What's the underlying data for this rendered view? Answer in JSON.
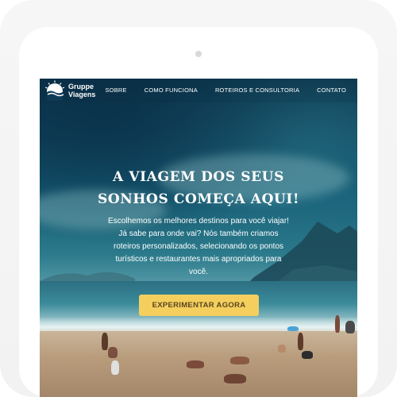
{
  "brand": {
    "name_line1": "Gruppe",
    "name_line2": "Viagens",
    "logo_icon": "sun-over-waves-icon"
  },
  "nav": {
    "items": [
      {
        "label": "SOBRE"
      },
      {
        "label": "COMO FUNCIONA"
      },
      {
        "label": "ROTEIROS E CONSULTORIA"
      },
      {
        "label": "CONTATO"
      }
    ]
  },
  "hero": {
    "title_line1": "A VIAGEM DOS SEUS",
    "title_line2": "SONHOS COMEÇA AQUI!",
    "sub_line1": "Escolhemos os melhores destinos para você viajar!",
    "sub_line2": "Já sabe para onde vai? Nós também criamos roteiros personalizados, selecionando os pontos turísticos e restaurantes mais apropriados para você.",
    "cta_label": "EXPERIMENTAR AGORA"
  },
  "colors": {
    "cta_background": "#f4cf5d",
    "cta_text": "#5a4420",
    "text_on_hero": "#ffffff"
  }
}
